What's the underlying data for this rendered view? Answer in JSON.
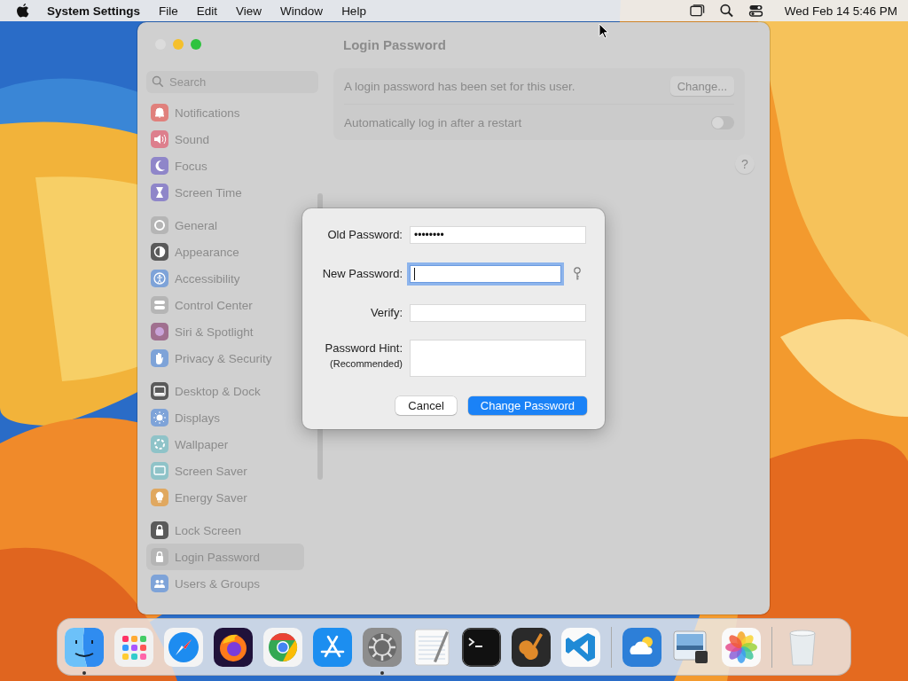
{
  "menubar": {
    "app_name": "System Settings",
    "menus": [
      "File",
      "Edit",
      "View",
      "Window",
      "Help"
    ],
    "clock": "Wed Feb 14  5:46 PM"
  },
  "window": {
    "search": {
      "placeholder": "Search"
    },
    "sidebar": {
      "groups": [
        {
          "items": [
            {
              "label": "Notifications",
              "kind": "bell",
              "color": "#e0807c",
              "selected": false
            },
            {
              "label": "Sound",
              "kind": "speaker",
              "color": "#dd7f8d",
              "selected": false
            },
            {
              "label": "Focus",
              "kind": "moon",
              "color": "#8f86c9",
              "selected": false
            },
            {
              "label": "Screen Time",
              "kind": "hourglass",
              "color": "#8f86c9",
              "selected": false
            }
          ]
        },
        {
          "items": [
            {
              "label": "General",
              "kind": "gear",
              "color": "#b5b5b5",
              "selected": false
            },
            {
              "label": "Appearance",
              "kind": "halfcircle",
              "color": "#5a5a5a",
              "selected": false
            },
            {
              "label": "Accessibility",
              "kind": "person",
              "color": "#7ea3d8",
              "selected": false
            },
            {
              "label": "Control Center",
              "kind": "toggles",
              "color": "#b5b5b5",
              "selected": false
            },
            {
              "label": "Siri & Spotlight",
              "kind": "orb",
              "color": "#a0708f",
              "selected": false
            },
            {
              "label": "Privacy & Security",
              "kind": "hand",
              "color": "#7ea3d8",
              "selected": false
            }
          ]
        },
        {
          "items": [
            {
              "label": "Desktop & Dock",
              "kind": "dock",
              "color": "#5a5a5a",
              "selected": false
            },
            {
              "label": "Displays",
              "kind": "sun",
              "color": "#7ea3d8",
              "selected": false
            },
            {
              "label": "Wallpaper",
              "kind": "flower",
              "color": "#8fc3c8",
              "selected": false
            },
            {
              "label": "Screen Saver",
              "kind": "screen",
              "color": "#8fc3c8",
              "selected": false
            },
            {
              "label": "Energy Saver",
              "kind": "bulb",
              "color": "#e0a860",
              "selected": false
            }
          ]
        },
        {
          "items": [
            {
              "label": "Lock Screen",
              "kind": "lock",
              "color": "#5a5a5a",
              "selected": false
            },
            {
              "label": "Login Password",
              "kind": "lock",
              "color": "#b5b5b5",
              "selected": true
            },
            {
              "label": "Users & Groups",
              "kind": "people",
              "color": "#7ea3d8",
              "selected": false
            }
          ]
        }
      ]
    },
    "content": {
      "title": "Login Password",
      "rows": [
        {
          "kind": "button",
          "label": "A login password has been set for this user.",
          "button": "Change..."
        },
        {
          "kind": "toggle",
          "label": "Automatically log in after a restart",
          "on": false
        }
      ],
      "help": "?"
    }
  },
  "dialog": {
    "fields": [
      {
        "kind": "password",
        "label": "Old Password:",
        "value": "••••••••",
        "focused": false,
        "assistant": false
      },
      {
        "kind": "password",
        "label": "New Password:",
        "focused": true,
        "assistant": true
      },
      {
        "kind": "password",
        "label": "Verify:",
        "focused": false,
        "assistant": false
      },
      {
        "kind": "multiline",
        "label": "Password Hint:",
        "sublabel": "(Recommended)",
        "focused": false,
        "assistant": false
      }
    ],
    "buttons": [
      {
        "label": "Cancel",
        "default": false
      },
      {
        "label": "Change Password",
        "default": true
      }
    ]
  },
  "dock": {
    "sections": [
      {
        "items": [
          {
            "kind": "finder",
            "running": true
          },
          {
            "kind": "launchpad",
            "running": false
          },
          {
            "kind": "safari",
            "running": false
          },
          {
            "kind": "firefox",
            "running": false
          },
          {
            "kind": "chrome",
            "running": false
          },
          {
            "kind": "appstore",
            "running": false
          },
          {
            "kind": "settings",
            "running": true
          },
          {
            "kind": "textedit",
            "running": false
          },
          {
            "kind": "terminal",
            "running": false
          },
          {
            "kind": "garageband",
            "running": false
          },
          {
            "kind": "vscode",
            "running": false
          }
        ]
      },
      {
        "items": [
          {
            "kind": "weather",
            "running": false
          },
          {
            "kind": "preview",
            "running": false
          },
          {
            "kind": "photos",
            "running": false
          }
        ]
      },
      {
        "items": [
          {
            "kind": "trash",
            "running": false
          }
        ]
      }
    ]
  }
}
